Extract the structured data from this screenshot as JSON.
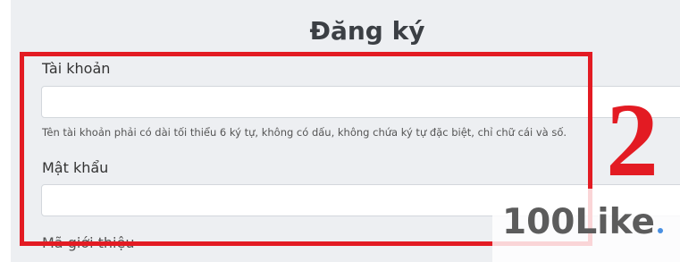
{
  "form": {
    "title": "Đăng ký",
    "username": {
      "label": "Tài khoản",
      "value": "",
      "placeholder": "",
      "help": "Tên tài khoản phải có dài tối thiểu 6 ký tự, không có dấu, không chứa ký tự đặc biệt, chỉ chữ cái và số."
    },
    "password": {
      "label": "Mật khẩu",
      "value": "",
      "placeholder": ""
    },
    "next_label_partial": "Mã giới thiệu"
  },
  "annotation": {
    "step_number": "2",
    "color": "#e31b23"
  },
  "watermark": {
    "text": "100Like",
    "dot_color": "#4a90e2"
  }
}
